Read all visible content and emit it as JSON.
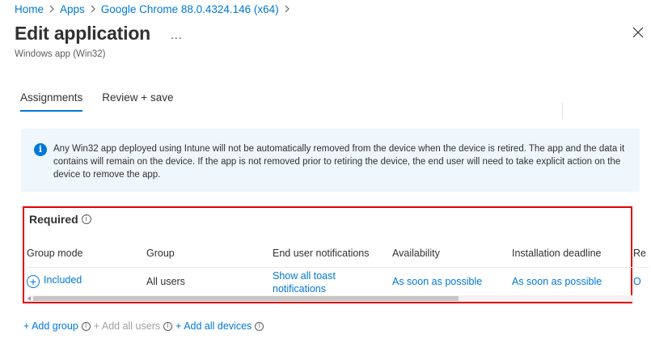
{
  "breadcrumb": {
    "items": [
      "Home",
      "Apps",
      "Google Chrome 88.0.4324.146 (x64)"
    ]
  },
  "header": {
    "title": "Edit application",
    "more_label": "...",
    "subtitle": "Windows app (Win32)"
  },
  "tabs": [
    {
      "label": "Assignments",
      "active": true
    },
    {
      "label": "Review + save",
      "active": false
    }
  ],
  "info": {
    "text": "Any Win32 app deployed using Intune will not be automatically removed from the device when the device is retired. The app and the data it contains will remain on the device. If the app is not removed prior to retiring the device, the end user will need to take explicit action on the device to remove the app."
  },
  "required": {
    "title": "Required",
    "columns": [
      "Group mode",
      "Group",
      "End user notifications",
      "Availability",
      "Installation deadline",
      "Re"
    ],
    "rows": [
      {
        "group_mode": "Included",
        "group": "All users",
        "notifications_line1": "Show all toast",
        "notifications_line2": "notifications",
        "availability": "As soon as possible",
        "deadline": "As soon as possible",
        "overflow": "O"
      }
    ]
  },
  "actions": {
    "add_group": "+ Add group",
    "add_all_users": "+ Add all users",
    "add_all_devices": "+ Add all devices"
  },
  "colors": {
    "accent": "#0078d4",
    "highlight_border": "#e00000",
    "info_bg": "#eff6fc"
  }
}
